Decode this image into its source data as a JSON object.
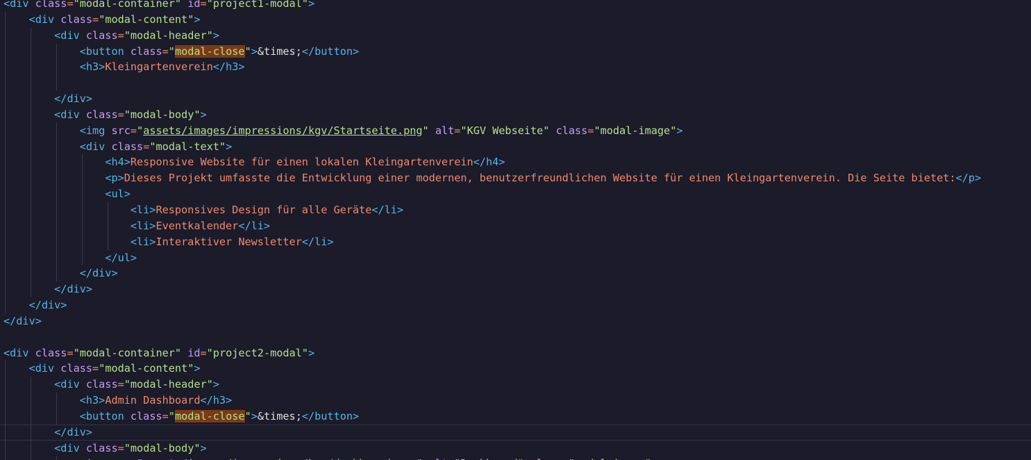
{
  "editor": {
    "language": "html",
    "colors": {
      "background": "#1b1b2a",
      "tag": "#56b6e6",
      "attribute": "#c69ef0",
      "string": "#b5e08a",
      "text": "#f08a6a",
      "highlight": "#7a3a17"
    },
    "lines": [
      {
        "indent": 0,
        "tokens": [
          [
            "tag",
            "<div"
          ],
          [
            "attr",
            " class"
          ],
          [
            "text",
            "="
          ],
          [
            "str",
            "\"modal-container\""
          ],
          [
            "attr",
            " id"
          ],
          [
            "text",
            "="
          ],
          [
            "str",
            "\"project1-modal\""
          ],
          [
            "tag",
            ">"
          ]
        ]
      },
      {
        "indent": 1,
        "tokens": [
          [
            "tag",
            "<div"
          ],
          [
            "attr",
            " class"
          ],
          [
            "text",
            "="
          ],
          [
            "str",
            "\"modal-content\""
          ],
          [
            "tag",
            ">"
          ]
        ]
      },
      {
        "indent": 2,
        "tokens": [
          [
            "tag",
            "<div"
          ],
          [
            "attr",
            " class"
          ],
          [
            "text",
            "="
          ],
          [
            "str",
            "\"modal-header\""
          ],
          [
            "tag",
            ">"
          ]
        ]
      },
      {
        "indent": 3,
        "tokens": [
          [
            "tag",
            "<button"
          ],
          [
            "attr",
            " class"
          ],
          [
            "text",
            "="
          ],
          [
            "str",
            "\""
          ],
          [
            "hl",
            "modal-close"
          ],
          [
            "str",
            "\""
          ],
          [
            "tag",
            ">"
          ],
          [
            "ent",
            "&times;"
          ],
          [
            "tag",
            "</button>"
          ]
        ]
      },
      {
        "indent": 3,
        "tokens": [
          [
            "tag",
            "<h3>"
          ],
          [
            "text",
            "Kleingartenverein"
          ],
          [
            "tag",
            "</h3>"
          ]
        ]
      },
      {
        "indent": 3,
        "tokens": []
      },
      {
        "indent": 2,
        "tokens": [
          [
            "tag",
            "</div>"
          ]
        ]
      },
      {
        "indent": 2,
        "tokens": [
          [
            "tag",
            "<div"
          ],
          [
            "attr",
            " class"
          ],
          [
            "text",
            "="
          ],
          [
            "str",
            "\"modal-body\""
          ],
          [
            "tag",
            ">"
          ]
        ]
      },
      {
        "indent": 3,
        "tokens": [
          [
            "tag",
            "<img"
          ],
          [
            "attr",
            " src"
          ],
          [
            "text",
            "="
          ],
          [
            "str",
            "\""
          ],
          [
            "link",
            "assets/images/impressions/kgv/Startseite.png"
          ],
          [
            "str",
            "\""
          ],
          [
            "attr",
            " alt"
          ],
          [
            "text",
            "="
          ],
          [
            "str",
            "\"KGV Webseite\""
          ],
          [
            "attr",
            " class"
          ],
          [
            "text",
            "="
          ],
          [
            "str",
            "\"modal-image\""
          ],
          [
            "tag",
            ">"
          ]
        ]
      },
      {
        "indent": 3,
        "tokens": [
          [
            "tag",
            "<div"
          ],
          [
            "attr",
            " class"
          ],
          [
            "text",
            "="
          ],
          [
            "str",
            "\"modal-text\""
          ],
          [
            "tag",
            ">"
          ]
        ]
      },
      {
        "indent": 4,
        "tokens": [
          [
            "tag",
            "<h4>"
          ],
          [
            "text",
            "Responsive Website für einen lokalen Kleingartenverein"
          ],
          [
            "tag",
            "</h4>"
          ]
        ]
      },
      {
        "indent": 4,
        "tokens": [
          [
            "tag",
            "<p>"
          ],
          [
            "text",
            "Dieses Projekt umfasste die Entwicklung einer modernen, benutzerfreundlichen Website für einen Kleingartenverein. Die Seite bietet:"
          ],
          [
            "tag",
            "</p>"
          ]
        ]
      },
      {
        "indent": 4,
        "tokens": [
          [
            "tag",
            "<ul>"
          ]
        ]
      },
      {
        "indent": 5,
        "tokens": [
          [
            "tag",
            "<li>"
          ],
          [
            "text",
            "Responsives Design für alle Geräte"
          ],
          [
            "tag",
            "</li>"
          ]
        ]
      },
      {
        "indent": 5,
        "tokens": [
          [
            "tag",
            "<li>"
          ],
          [
            "text",
            "Eventkalender"
          ],
          [
            "tag",
            "</li>"
          ]
        ]
      },
      {
        "indent": 5,
        "tokens": [
          [
            "tag",
            "<li>"
          ],
          [
            "text",
            "Interaktiver Newsletter"
          ],
          [
            "tag",
            "</li>"
          ]
        ]
      },
      {
        "indent": 4,
        "tokens": [
          [
            "tag",
            "</ul>"
          ]
        ]
      },
      {
        "indent": 3,
        "tokens": [
          [
            "tag",
            "</div>"
          ]
        ]
      },
      {
        "indent": 2,
        "tokens": [
          [
            "tag",
            "</div>"
          ]
        ]
      },
      {
        "indent": 1,
        "tokens": [
          [
            "tag",
            "</div>"
          ]
        ]
      },
      {
        "indent": 0,
        "tokens": [
          [
            "tag",
            "</div>"
          ]
        ]
      },
      {
        "indent": 0,
        "tokens": []
      },
      {
        "indent": 0,
        "tokens": [
          [
            "tag",
            "<div"
          ],
          [
            "attr",
            " class"
          ],
          [
            "text",
            "="
          ],
          [
            "str",
            "\"modal-container\""
          ],
          [
            "attr",
            " id"
          ],
          [
            "text",
            "="
          ],
          [
            "str",
            "\"project2-modal\""
          ],
          [
            "tag",
            ">"
          ]
        ]
      },
      {
        "indent": 1,
        "tokens": [
          [
            "tag",
            "<div"
          ],
          [
            "attr",
            " class"
          ],
          [
            "text",
            "="
          ],
          [
            "str",
            "\"modal-content\""
          ],
          [
            "tag",
            ">"
          ]
        ]
      },
      {
        "indent": 2,
        "tokens": [
          [
            "tag",
            "<div"
          ],
          [
            "attr",
            " class"
          ],
          [
            "text",
            "="
          ],
          [
            "str",
            "\"modal-header\""
          ],
          [
            "tag",
            ">"
          ]
        ]
      },
      {
        "indent": 3,
        "tokens": [
          [
            "tag",
            "<h3>"
          ],
          [
            "text",
            "Admin Dashboard"
          ],
          [
            "tag",
            "</h3>"
          ]
        ]
      },
      {
        "indent": 3,
        "tokens": [
          [
            "tag",
            "<button"
          ],
          [
            "attr",
            " class"
          ],
          [
            "text",
            "="
          ],
          [
            "str",
            "\""
          ],
          [
            "hl",
            "modal-close"
          ],
          [
            "str",
            "\""
          ],
          [
            "tag",
            ">"
          ],
          [
            "ent",
            "&times;"
          ],
          [
            "tag",
            "</button>"
          ]
        ]
      },
      {
        "indent": 2,
        "current": true,
        "tokens": [
          [
            "tag",
            "</div>"
          ]
        ]
      },
      {
        "indent": 2,
        "tokens": [
          [
            "tag",
            "<div"
          ],
          [
            "attr",
            " class"
          ],
          [
            "text",
            "="
          ],
          [
            "str",
            "\"modal-body\""
          ],
          [
            "tag",
            ">"
          ]
        ]
      },
      {
        "indent": 3,
        "tokens": [
          [
            "tag",
            "<img"
          ],
          [
            "attr",
            " src"
          ],
          [
            "text",
            "="
          ],
          [
            "str",
            "\"assets/images/impressions/kgv/dashboard.png\""
          ],
          [
            "attr",
            " alt"
          ],
          [
            "text",
            "="
          ],
          [
            "str",
            "\"Dashboard\""
          ],
          [
            "attr",
            " class"
          ],
          [
            "text",
            "="
          ],
          [
            "str",
            "\"modal-image\""
          ],
          [
            "tag",
            ">"
          ]
        ]
      }
    ]
  }
}
